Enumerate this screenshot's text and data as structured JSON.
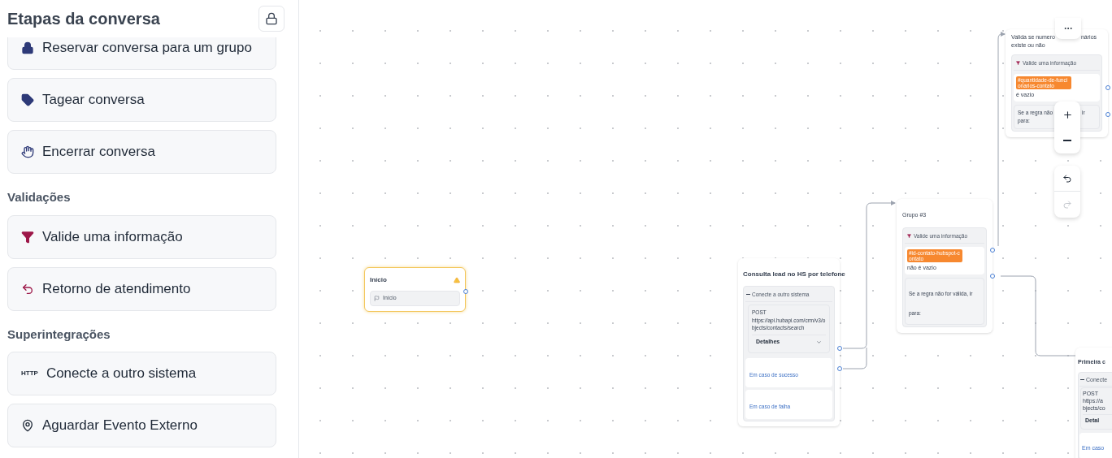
{
  "sidebar": {
    "title": "Etapas da conversa",
    "sections": [
      {
        "items": [
          {
            "kind": "lock",
            "label": "Reservar conversa para um grupo"
          },
          {
            "kind": "tag",
            "label": "Tagear conversa"
          },
          {
            "kind": "hand",
            "label": "Encerrar conversa"
          }
        ]
      },
      {
        "title": "Validações",
        "items": [
          {
            "kind": "filter",
            "label": "Valide uma informação"
          },
          {
            "kind": "return",
            "label": "Retorno de atendimento"
          }
        ]
      },
      {
        "title": "Superintegrações",
        "items": [
          {
            "kind": "http",
            "icon_text": "HTTP",
            "label": "Conecte a outro sistema"
          },
          {
            "kind": "pin",
            "label": "Aguardar Evento Externo"
          }
        ]
      }
    ]
  },
  "canvas": {
    "nodes": [
      {
        "kind": "start",
        "title": "Início",
        "warning": true,
        "step": "Início"
      },
      {
        "kind": "integration",
        "title": "Consulta lead no HS por telefone",
        "step": "Conecte a outro sistema",
        "method": "POST",
        "url_lines": [
          "https://api.hubapi.com/crm/v3/o",
          "bjects/contacts/search"
        ],
        "details": "Detalhes",
        "outputs": [
          "Em caso de sucesso",
          "Em caso de falha"
        ]
      },
      {
        "kind": "validation",
        "title": [
          "Grupo #3"
        ],
        "step": "Valide uma informação",
        "tag": "#id-contato-hubspot-contato",
        "condition": "não é vazio",
        "fallback": [
          "Se a regra não for válida, ir para:"
        ]
      },
      {
        "kind": "validation",
        "title": [
          "Valida se numero",
          "nários",
          "existe ou não"
        ],
        "step": "Valide uma informação",
        "tag": "#quantidade-de-funcionarios-contato",
        "condition": "é vazio",
        "fallback": [
          "Se a regra não",
          "ir",
          "para:"
        ]
      },
      {
        "kind": "integration",
        "title": "Primeira c",
        "step": "Conecte",
        "method": "POST",
        "url_lines": [
          "https://a",
          "bjects/co"
        ],
        "details": "Detal",
        "outputs": [
          "Em caso"
        ]
      }
    ],
    "controls": {
      "undo": {
        "disabled": false
      },
      "redo": {
        "disabled": true
      }
    }
  }
}
